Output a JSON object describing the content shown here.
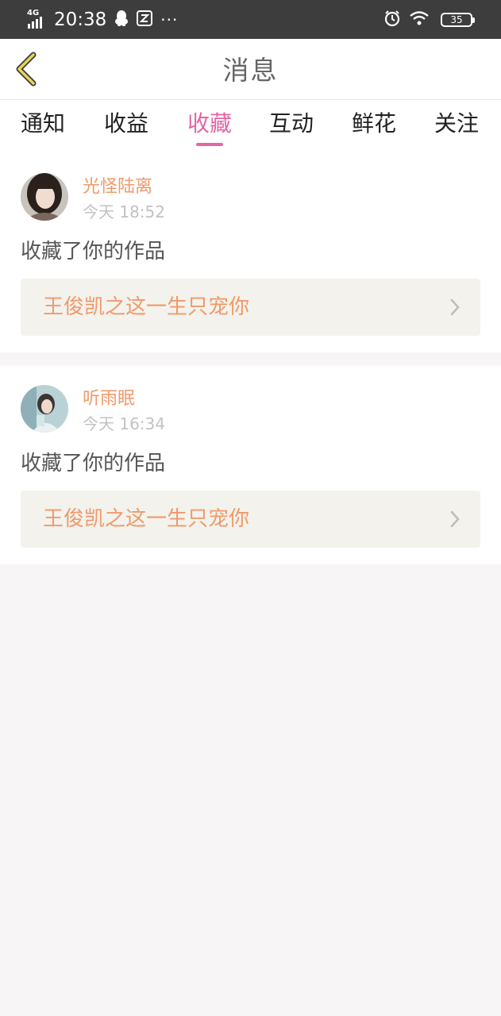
{
  "status_bar": {
    "network": "4G",
    "time": "20:38",
    "battery": "35",
    "overflow": "···"
  },
  "header": {
    "title": "消息",
    "back_icon": "chevron-left-icon",
    "accent_color": "#e8d25c"
  },
  "tabs": [
    {
      "label": "通知",
      "active": false
    },
    {
      "label": "收益",
      "active": false
    },
    {
      "label": "收藏",
      "active": true
    },
    {
      "label": "互动",
      "active": false
    },
    {
      "label": "鲜花",
      "active": false
    },
    {
      "label": "关注",
      "active": false
    }
  ],
  "colors": {
    "active_tab": "#e466a4",
    "username": "#ef9a6b",
    "link_bg": "#f3f2ec"
  },
  "messages": [
    {
      "username": "光怪陆离",
      "time": "今天 18:52",
      "action": "收藏了你的作品",
      "work_title": "王俊凯之这一生只宠你"
    },
    {
      "username": "听雨眠",
      "time": "今天 16:34",
      "action": "收藏了你的作品",
      "work_title": "王俊凯之这一生只宠你"
    }
  ]
}
